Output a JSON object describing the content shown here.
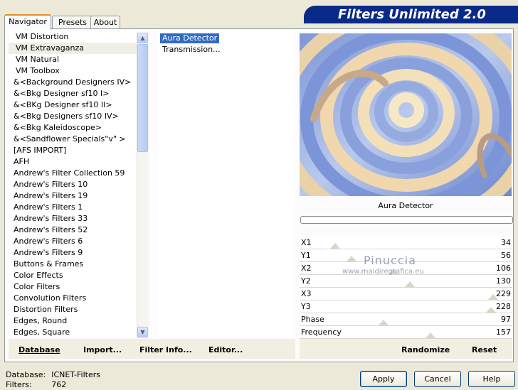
{
  "tabs": [
    "Navigator",
    "Presets",
    "About"
  ],
  "banner_title": "Filters Unlimited 2.0",
  "categories": [
    "VM Distortion",
    "VM Extravaganza",
    "VM Natural",
    "VM Toolbox",
    "&<Background Designers IV>",
    "&<Bkg Designer sf10 I>",
    "&<BKg Designer sf10 II>",
    "&<Bkg Designers sf10 IV>",
    "&<Bkg Kaleidoscope>",
    "&<Sandflower Specials\"v\" >",
    "[AFS IMPORT]",
    "AFH",
    "Andrew's Filter Collection 59",
    "Andrew's Filters 10",
    "Andrew's Filters 19",
    "Andrew's Filters 1",
    "Andrew's Filters 33",
    "Andrew's Filters 52",
    "Andrew's Filters 6",
    "Andrew's Filters 9",
    "Buttons & Frames",
    "Color Effects",
    "Color Filters",
    "Convolution Filters",
    "Distortion Filters",
    "Edges, Round",
    "Edges, Square"
  ],
  "selected_category": "VM Extravaganza",
  "filters": [
    "Aura Detector",
    "Transmission..."
  ],
  "selected_filter": "Aura Detector",
  "preview_label": "Aura Detector",
  "params": [
    {
      "name": "X1",
      "value": "34",
      "level": 0.15
    },
    {
      "name": "Y1",
      "value": "56",
      "level": 0.23
    },
    {
      "name": "X2",
      "value": "106",
      "level": 0.44
    },
    {
      "name": "Y2",
      "value": "130",
      "level": 0.52
    },
    {
      "name": "X3",
      "value": "229",
      "level": 0.93
    },
    {
      "name": "Y3",
      "value": "228",
      "level": 0.92
    },
    {
      "name": "Phase",
      "value": "97",
      "level": 0.39
    },
    {
      "name": "Frequency",
      "value": "157",
      "level": 0.62
    }
  ],
  "watermark": {
    "line1": "Pinuccia",
    "line2": "www.maidiregrafica.eu"
  },
  "bottom_left_buttons": [
    "Database",
    "Import...",
    "Filter Info...",
    "Editor..."
  ],
  "bottom_right_buttons": [
    "Randomize",
    "Reset"
  ],
  "status": {
    "database_label": "Database:",
    "database_value": "ICNET-Filters",
    "filters_label": "Filters:",
    "filters_value": "762"
  },
  "dialog_buttons": {
    "apply": "Apply",
    "cancel": "Cancel",
    "help": "Help"
  }
}
